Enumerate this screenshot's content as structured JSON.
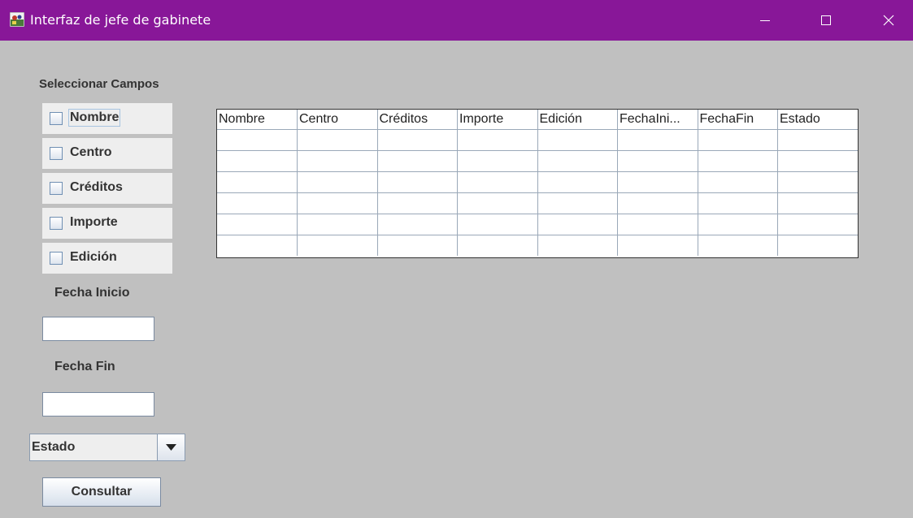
{
  "window": {
    "title": "Interfaz de jefe de gabinete",
    "icons": [
      "app-icon",
      "minimize-icon",
      "maximize-icon",
      "close-icon"
    ],
    "title_bar_color": "#881798",
    "background_color": "#c0c0c0"
  },
  "fields": {
    "section_label": "Seleccionar Campos",
    "checkboxes": [
      {
        "label": "Nombre",
        "checked": false
      },
      {
        "label": "Centro",
        "checked": false
      },
      {
        "label": "Créditos",
        "checked": false
      },
      {
        "label": "Importe",
        "checked": false
      },
      {
        "label": "Edición",
        "checked": false
      }
    ],
    "fecha_inicio_label": "Fecha Inicio",
    "fecha_inicio_value": "",
    "fecha_fin_label": "Fecha Fin",
    "fecha_fin_value": "",
    "estado_selected": "Estado",
    "consultar_label": "Consultar"
  },
  "table": {
    "columns": [
      "Nombre",
      "Centro",
      "Créditos",
      "Importe",
      "Edición",
      "FechaIni...",
      "FechaFin",
      "Estado"
    ],
    "rows": [
      [
        "",
        "",
        "",
        "",
        "",
        "",
        "",
        ""
      ],
      [
        "",
        "",
        "",
        "",
        "",
        "",
        "",
        ""
      ],
      [
        "",
        "",
        "",
        "",
        "",
        "",
        "",
        ""
      ],
      [
        "",
        "",
        "",
        "",
        "",
        "",
        "",
        ""
      ],
      [
        "",
        "",
        "",
        "",
        "",
        "",
        "",
        ""
      ],
      [
        "",
        "",
        "",
        "",
        "",
        "",
        "",
        ""
      ]
    ]
  }
}
